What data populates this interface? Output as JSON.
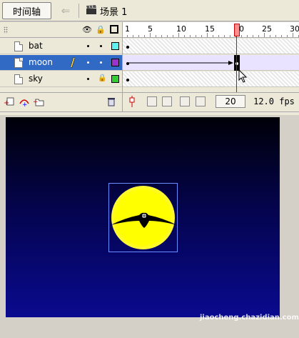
{
  "toolbar": {
    "timeline_tab": "时间轴",
    "scene_label": "场景 1"
  },
  "layer_header": {
    "eye_icon": "eye-icon",
    "lock_icon": "lock-icon",
    "outline_icon": "outline-square-icon"
  },
  "layers": [
    {
      "name": "bat",
      "color": "#5ff0f0",
      "selected": false
    },
    {
      "name": "moon",
      "color": "#9933cc",
      "selected": true
    },
    {
      "name": "sky",
      "color": "#33cc33",
      "selected": false,
      "locked": true
    }
  ],
  "ruler": {
    "labels": [
      "1",
      "5",
      "10",
      "15",
      "20",
      "25",
      "30"
    ],
    "current_marker": "20"
  },
  "status": {
    "current_frame": "20",
    "fps": "12.0 fps"
  },
  "colors": {
    "selection": "#316ac5",
    "playhead": "#ff0000",
    "moon": "#ffff00"
  },
  "watermark": "jiaocheng.chazidian.com"
}
